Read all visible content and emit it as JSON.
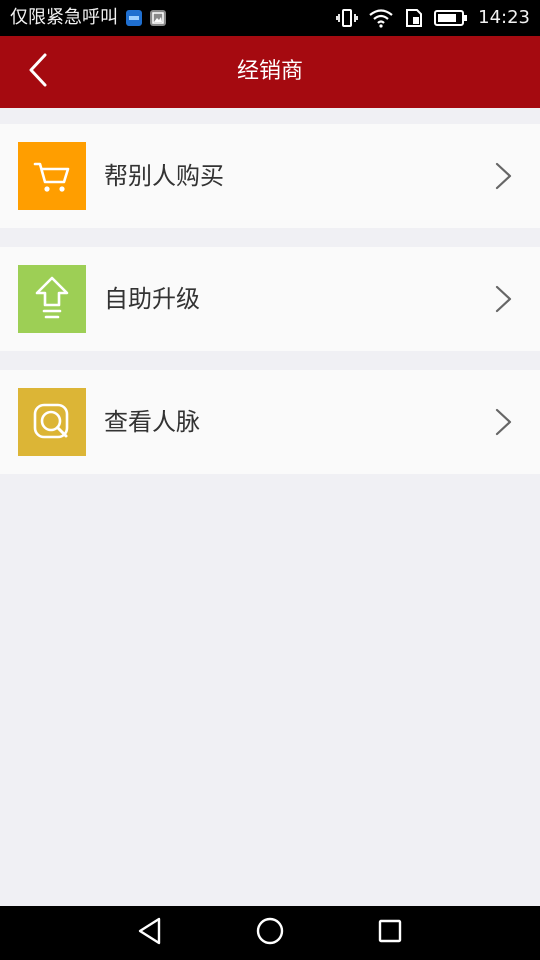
{
  "status_bar": {
    "left_text": "仅限紧急呼叫",
    "time": "14:23",
    "icons": [
      "notification-app-icon",
      "image-app-icon",
      "vibrate-icon",
      "wifi-icon",
      "sim-icon",
      "battery-icon"
    ]
  },
  "app_bar": {
    "title": "经销商",
    "back_icon": "back-chevron-icon"
  },
  "menu": {
    "items": [
      {
        "label": "帮别人购买",
        "icon": "cart-icon",
        "color": "#ff9e00"
      },
      {
        "label": "自助升级",
        "icon": "upgrade-arrow-icon",
        "color": "#9dcf55"
      },
      {
        "label": "查看人脉",
        "icon": "search-contacts-icon",
        "color": "#dcb536"
      }
    ]
  },
  "nav_bar": {
    "icons": [
      "nav-back-icon",
      "nav-home-icon",
      "nav-recent-icon"
    ]
  },
  "colors": {
    "app_bar": "#a50a10",
    "background": "#f0f0f4",
    "row": "#fafafa"
  }
}
